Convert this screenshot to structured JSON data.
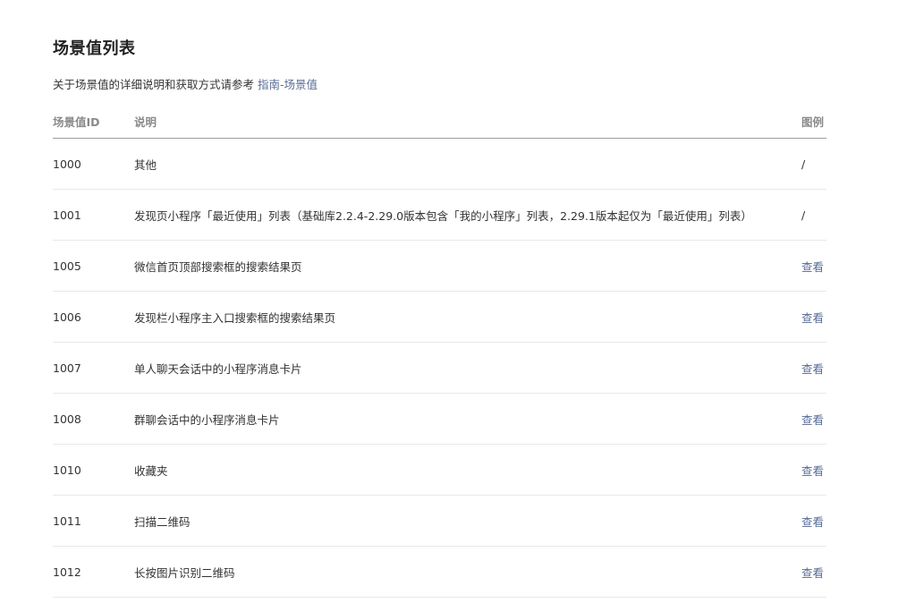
{
  "heading": "场景值列表",
  "intro": {
    "text": "关于场景值的详细说明和获取方式请参考",
    "link_label": "指南-场景值"
  },
  "table": {
    "columns": [
      "场景值ID",
      "说明",
      "图例"
    ],
    "rows": [
      {
        "id": "1000",
        "desc": "其他",
        "example": "/",
        "example_is_link": false
      },
      {
        "id": "1001",
        "desc": "发现页小程序「最近使用」列表（基础库2.2.4-2.29.0版本包含「我的小程序」列表，2.29.1版本起仅为「最近使用」列表）",
        "example": "/",
        "example_is_link": false
      },
      {
        "id": "1005",
        "desc": "微信首页顶部搜索框的搜索结果页",
        "example": "查看",
        "example_is_link": true
      },
      {
        "id": "1006",
        "desc": "发现栏小程序主入口搜索框的搜索结果页",
        "example": "查看",
        "example_is_link": true
      },
      {
        "id": "1007",
        "desc": "单人聊天会话中的小程序消息卡片",
        "example": "查看",
        "example_is_link": true
      },
      {
        "id": "1008",
        "desc": "群聊会话中的小程序消息卡片",
        "example": "查看",
        "example_is_link": true
      },
      {
        "id": "1010",
        "desc": "收藏夹",
        "example": "查看",
        "example_is_link": true
      },
      {
        "id": "1011",
        "desc": "扫描二维码",
        "example": "查看",
        "example_is_link": true
      },
      {
        "id": "1012",
        "desc": "长按图片识别二维码",
        "example": "查看",
        "example_is_link": true
      }
    ]
  },
  "colors": {
    "link": "#576b95",
    "text": "#333333",
    "header_text": "#8a8a8a"
  }
}
